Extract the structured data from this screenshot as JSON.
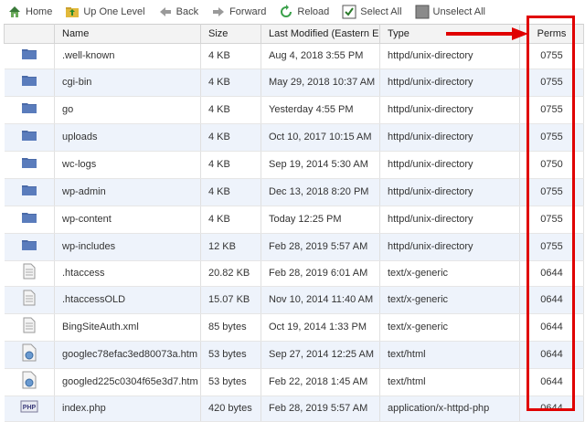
{
  "toolbar": {
    "home": "Home",
    "up_one_level": "Up One Level",
    "back": "Back",
    "forward": "Forward",
    "reload": "Reload",
    "select_all": "Select All",
    "unselect_all": "Unselect All"
  },
  "columns": {
    "name": "Name",
    "size": "Size",
    "modified": "Last Modified (Eastern E",
    "type": "Type",
    "perms": "Perms"
  },
  "files": [
    {
      "icon": "folder-icon",
      "name": ".well-known",
      "size": "4 KB",
      "modified": "Aug 4, 2018 3:55 PM",
      "type": "httpd/unix-directory",
      "perms": "0755"
    },
    {
      "icon": "folder-icon",
      "name": "cgi-bin",
      "size": "4 KB",
      "modified": "May 29, 2018 10:37 AM",
      "type": "httpd/unix-directory",
      "perms": "0755"
    },
    {
      "icon": "folder-icon",
      "name": "go",
      "size": "4 KB",
      "modified": "Yesterday 4:55 PM",
      "type": "httpd/unix-directory",
      "perms": "0755"
    },
    {
      "icon": "folder-icon",
      "name": "uploads",
      "size": "4 KB",
      "modified": "Oct 10, 2017 10:15 AM",
      "type": "httpd/unix-directory",
      "perms": "0755"
    },
    {
      "icon": "folder-icon",
      "name": "wc-logs",
      "size": "4 KB",
      "modified": "Sep 19, 2014 5:30 AM",
      "type": "httpd/unix-directory",
      "perms": "0750"
    },
    {
      "icon": "folder-icon",
      "name": "wp-admin",
      "size": "4 KB",
      "modified": "Dec 13, 2018 8:20 PM",
      "type": "httpd/unix-directory",
      "perms": "0755"
    },
    {
      "icon": "folder-icon",
      "name": "wp-content",
      "size": "4 KB",
      "modified": "Today 12:25 PM",
      "type": "httpd/unix-directory",
      "perms": "0755"
    },
    {
      "icon": "folder-icon",
      "name": "wp-includes",
      "size": "12 KB",
      "modified": "Feb 28, 2019 5:57 AM",
      "type": "httpd/unix-directory",
      "perms": "0755"
    },
    {
      "icon": "text-file-icon",
      "name": ".htaccess",
      "size": "20.82 KB",
      "modified": "Feb 28, 2019 6:01 AM",
      "type": "text/x-generic",
      "perms": "0644"
    },
    {
      "icon": "text-file-icon",
      "name": ".htaccessOLD",
      "size": "15.07 KB",
      "modified": "Nov 10, 2014 11:40 AM",
      "type": "text/x-generic",
      "perms": "0644"
    },
    {
      "icon": "text-file-icon",
      "name": "BingSiteAuth.xml",
      "size": "85 bytes",
      "modified": "Oct 19, 2014 1:33 PM",
      "type": "text/x-generic",
      "perms": "0644"
    },
    {
      "icon": "html-file-icon",
      "name": "googlec78efac3ed80073a.htm",
      "size": "53 bytes",
      "modified": "Sep 27, 2014 12:25 AM",
      "type": "text/html",
      "perms": "0644"
    },
    {
      "icon": "html-file-icon",
      "name": "googled225c0304f65e3d7.htm",
      "size": "53 bytes",
      "modified": "Feb 22, 2018 1:45 AM",
      "type": "text/html",
      "perms": "0644"
    },
    {
      "icon": "php-file-icon",
      "name": "index.php",
      "size": "420 bytes",
      "modified": "Feb 28, 2019 5:57 AM",
      "type": "application/x-httpd-php",
      "perms": "0644"
    }
  ],
  "colors": {
    "annotation": "#e00000",
    "row_alt": "#eef3fb",
    "folder": "#4a6aa8"
  }
}
